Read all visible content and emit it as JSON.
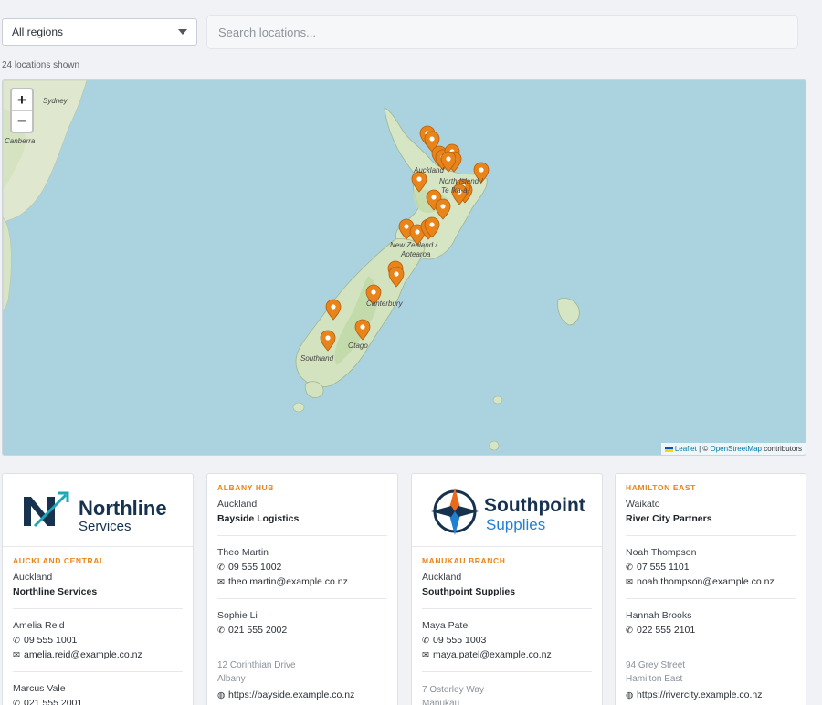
{
  "filter": {
    "selected": "All regions"
  },
  "search": {
    "placeholder": "Search locations..."
  },
  "summary": {
    "count_text": "24 locations shown"
  },
  "map": {
    "zoom_in": "+",
    "zoom_out": "−",
    "labels": {
      "sydney": "Sydney",
      "canberra": "Canberra",
      "auckland": "Auckland",
      "north_island": "North Island /",
      "te_ika": "Te Ika-a-",
      "nz": "New Zealand /",
      "aotearoa": "Aotearoa",
      "canterbury": "Canterbury",
      "otago": "Otago",
      "southland": "Southland"
    },
    "attribution": {
      "leaflet": "Leaflet",
      "sep": " | © ",
      "osm": "OpenStreetMap",
      "suffix": " contributors"
    },
    "pin_color": "#e8841a",
    "water_color": "#aad3df"
  },
  "cards": [
    {
      "logo": {
        "line1": "Northline",
        "line2": "Services"
      },
      "branch": "Auckland Central",
      "city": "Auckland",
      "company": "Northline Services",
      "contacts": [
        {
          "name": "Amelia Reid",
          "phone": "09 555 1001",
          "email": "amelia.reid@example.co.nz"
        },
        {
          "name": "Marcus Vale",
          "phone": "021 555 2001"
        }
      ]
    },
    {
      "branch": "Albany Hub",
      "city": "Auckland",
      "company": "Bayside Logistics",
      "contacts": [
        {
          "name": "Theo Martin",
          "phone": "09 555 1002",
          "email": "theo.martin@example.co.nz"
        },
        {
          "name": "Sophie Li",
          "phone": "021 555 2002"
        }
      ],
      "address": {
        "street": "12 Corinthian Drive",
        "suburb": "Albany",
        "website": "https://bayside.example.co.nz"
      }
    },
    {
      "logo": {
        "line1": "Southpoint",
        "line2": "Supplies"
      },
      "branch": "Manukau Branch",
      "city": "Auckland",
      "company": "Southpoint Supplies",
      "contacts": [
        {
          "name": "Maya Patel",
          "phone": "09 555 1003",
          "email": "maya.patel@example.co.nz"
        }
      ],
      "address": {
        "street": "7 Osterley Way",
        "suburb": "Manukau"
      }
    },
    {
      "branch": "Hamilton East",
      "city": "Waikato",
      "company": "River City Partners",
      "contacts": [
        {
          "name": "Noah Thompson",
          "phone": "07 555 1101",
          "email": "noah.thompson@example.co.nz"
        },
        {
          "name": "Hannah Brooks",
          "phone": "022 555 2101"
        }
      ],
      "address": {
        "street": "94 Grey Street",
        "suburb": "Hamilton East",
        "website": "https://rivercity.example.co.nz"
      }
    }
  ]
}
